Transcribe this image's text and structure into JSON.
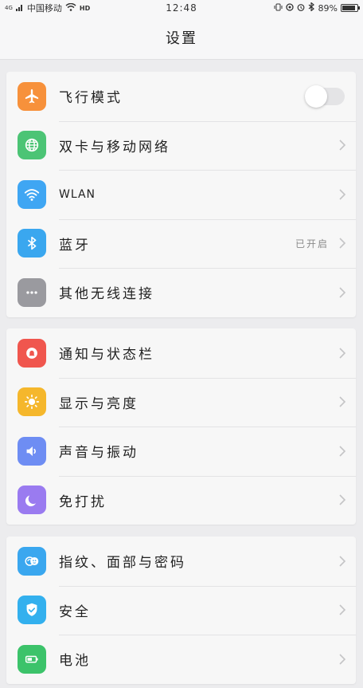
{
  "status_bar": {
    "carrier": "中国移动",
    "network": "4G",
    "hd": "HD",
    "time": "12:48",
    "battery": "89%",
    "battery_level": 0.89
  },
  "header": {
    "title": "设置"
  },
  "groups": [
    {
      "items": [
        {
          "label": "飞行模式",
          "icon": "airplane-icon",
          "color": "#f7913b",
          "control": "toggle",
          "toggle_on": false
        },
        {
          "label": "双卡与移动网络",
          "icon": "globe-icon",
          "color": "#4cc475",
          "control": "chevron"
        },
        {
          "label": "WLAN",
          "icon": "wifi-icon",
          "color": "#3fa6f3",
          "control": "chevron"
        },
        {
          "label": "蓝牙",
          "icon": "bluetooth-icon",
          "color": "#3aa7ef",
          "control": "chevron",
          "value": "已开启"
        },
        {
          "label": "其他无线连接",
          "icon": "more-dots-icon",
          "color": "#9a9a9f",
          "control": "chevron"
        }
      ]
    },
    {
      "items": [
        {
          "label": "通知与状态栏",
          "icon": "notification-icon",
          "color": "#f0564e",
          "control": "chevron"
        },
        {
          "label": "显示与亮度",
          "icon": "sun-icon",
          "color": "#f5b72c",
          "control": "chevron"
        },
        {
          "label": "声音与振动",
          "icon": "speaker-icon",
          "color": "#6e8df3",
          "control": "chevron"
        },
        {
          "label": "免打扰",
          "icon": "moon-icon",
          "color": "#9a7bf0",
          "control": "chevron"
        }
      ]
    },
    {
      "items": [
        {
          "label": "指纹、面部与密码",
          "icon": "fingerprint-face-icon",
          "color": "#3aa7ef",
          "control": "chevron"
        },
        {
          "label": "安全",
          "icon": "shield-icon",
          "color": "#33b0ee",
          "control": "chevron"
        },
        {
          "label": "电池",
          "icon": "battery-icon",
          "color": "#3cc36a",
          "control": "chevron"
        }
      ]
    }
  ]
}
